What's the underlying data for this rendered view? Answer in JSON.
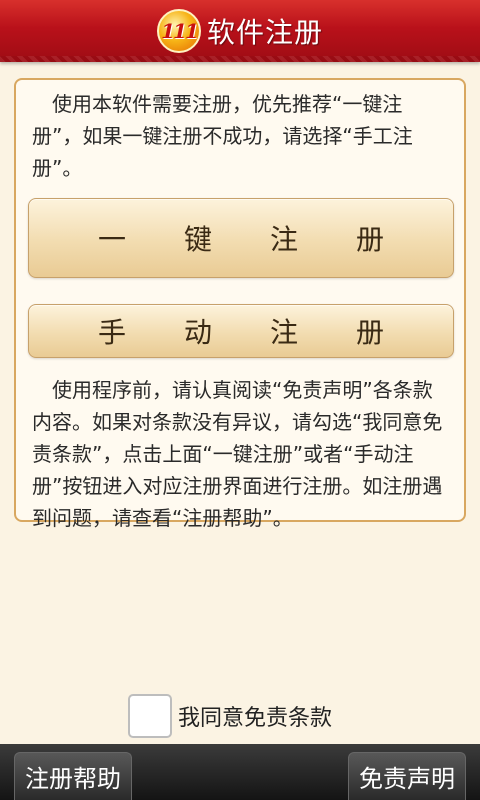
{
  "header": {
    "logo_text": "111",
    "title": "软件注册"
  },
  "intro_text": "使用本软件需要注册，优先推荐“一键注册”，如果一键注册不成功，请选择“手工注册”。",
  "buttons": {
    "one_key": [
      "一",
      "键",
      "注",
      "册"
    ],
    "manual": [
      "手",
      "动",
      "注",
      "册"
    ]
  },
  "notice_text": "使用程序前，请认真阅读“免责声明”各条款内容。如果对条款没有异议，请勾选“我同意免责条款”，点击上面“一键注册”或者“手动注册”按钮进入对应注册界面进行注册。如注册遇到问题，请查看“注册帮助”。",
  "agree": {
    "label": "我同意免责条款",
    "checked": false
  },
  "bottom_bar": {
    "help_label": "注册帮助",
    "disclaimer_label": "免责声明"
  },
  "colors": {
    "header_red": "#b9111a",
    "background": "#fbf3e3",
    "card_border": "#d8a760",
    "button_fill": "#f2dcb0"
  }
}
